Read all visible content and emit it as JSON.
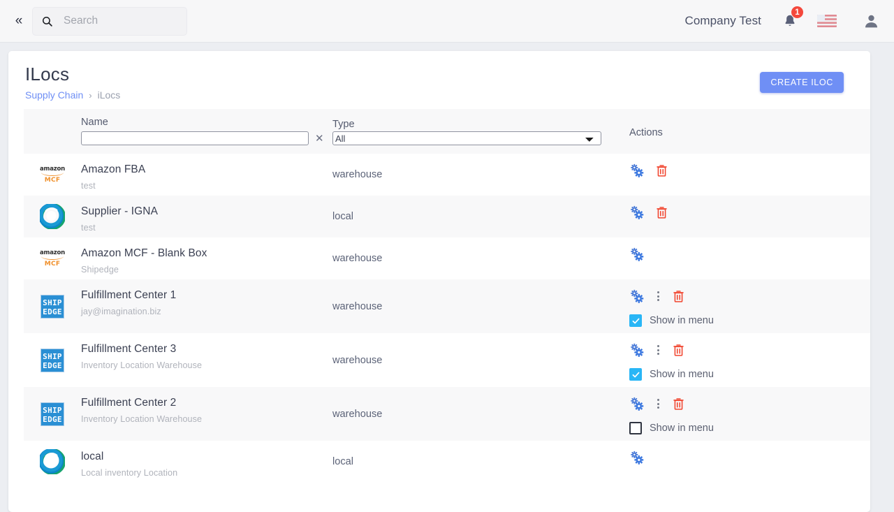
{
  "topbar": {
    "collapse_icon": "chevron-double-left-icon",
    "search": {
      "placeholder": "Search",
      "value": "",
      "icon": "search-icon"
    },
    "company": "Company Test",
    "notification_icon": "bell-icon",
    "notification_count": "1",
    "flag_icon": "us-flag-icon",
    "avatar_icon": "user-avatar-icon",
    "accent": "#6f8ff5",
    "badge_color": "#f4483c"
  },
  "page": {
    "title": "ILocs",
    "breadcrumb": {
      "parent": "Supply Chain",
      "separator": "›",
      "current": "iLocs"
    },
    "create_button": "CREATE ILOC"
  },
  "table": {
    "columns": {
      "name": "Name",
      "type": "Type",
      "actions": "Actions"
    },
    "filters": {
      "name_value": "",
      "name_clear_icon": "clear-x-icon",
      "type_selected": "All",
      "type_options": [
        "All",
        "warehouse",
        "local"
      ]
    },
    "show_in_menu_label": "Show in menu",
    "icons": {
      "settings": "gears-settings-icon",
      "delete": "trash-delete-icon",
      "more": "more-vertical-icon"
    },
    "rows": [
      {
        "logo": "amazon-mcf-logo",
        "name": "Amazon FBA",
        "sub": "test",
        "type": "warehouse",
        "has_settings": true,
        "has_more": false,
        "has_delete": true,
        "has_show_in_menu": false,
        "show_in_menu_checked": false
      },
      {
        "logo": "igna-swirl-logo",
        "name": "Supplier - IGNA",
        "sub": "test",
        "type": "local",
        "has_settings": true,
        "has_more": false,
        "has_delete": true,
        "has_show_in_menu": false,
        "show_in_menu_checked": false
      },
      {
        "logo": "amazon-mcf-logo",
        "name": "Amazon MCF - Blank Box",
        "sub": "Shipedge",
        "type": "warehouse",
        "has_settings": true,
        "has_more": false,
        "has_delete": false,
        "has_show_in_menu": false,
        "show_in_menu_checked": false
      },
      {
        "logo": "shipedge-logo",
        "name": "Fulfillment Center 1",
        "sub": "jay@imagination.biz",
        "type": "warehouse",
        "has_settings": true,
        "has_more": true,
        "has_delete": true,
        "has_show_in_menu": true,
        "show_in_menu_checked": true
      },
      {
        "logo": "shipedge-logo",
        "name": "Fulfillment Center 3",
        "sub": "Inventory Location Warehouse",
        "type": "warehouse",
        "has_settings": true,
        "has_more": true,
        "has_delete": true,
        "has_show_in_menu": true,
        "show_in_menu_checked": true
      },
      {
        "logo": "shipedge-logo",
        "name": "Fulfillment Center 2",
        "sub": "Inventory Location Warehouse",
        "type": "warehouse",
        "has_settings": true,
        "has_more": true,
        "has_delete": true,
        "has_show_in_menu": true,
        "show_in_menu_checked": false
      },
      {
        "logo": "igna-swirl-logo",
        "name": "local",
        "sub": "Local inventory Location",
        "type": "local",
        "has_settings": true,
        "has_more": false,
        "has_delete": false,
        "has_show_in_menu": false,
        "show_in_menu_checked": false
      }
    ]
  }
}
